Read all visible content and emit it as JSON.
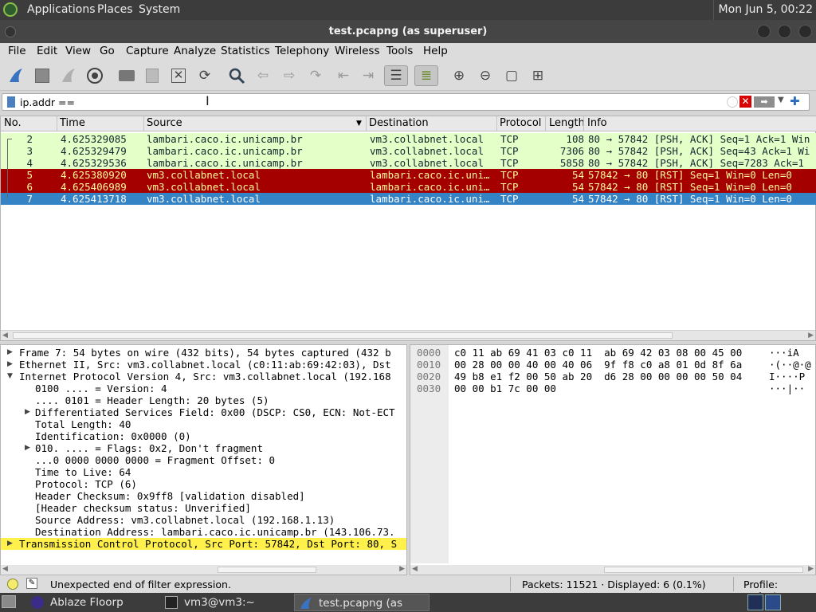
{
  "top_panel": {
    "applications": "Applications",
    "places": "Places",
    "system": "System",
    "clock": "Mon Jun  5, 00:22"
  },
  "window": {
    "title": "test.pcapng (as superuser)"
  },
  "menu": [
    "File",
    "Edit",
    "View",
    "Go",
    "Capture",
    "Analyze",
    "Statistics",
    "Telephony",
    "Wireless",
    "Tools",
    "Help"
  ],
  "filter": {
    "value": "ip.addr =="
  },
  "columns": {
    "no": "No.",
    "time": "Time",
    "source": "Source",
    "destination": "Destination",
    "protocol": "Protocol",
    "length": "Length",
    "info": "Info"
  },
  "packets": [
    {
      "no": "2",
      "time": "4.625329085",
      "src": "lambari.caco.ic.unicamp.br",
      "dst": "vm3.collabnet.local",
      "proto": "TCP",
      "len": "108",
      "info": "80 → 57842 [PSH, ACK] Seq=1 Ack=1 Win"
    },
    {
      "no": "3",
      "time": "4.625329479",
      "src": "lambari.caco.ic.unicamp.br",
      "dst": "vm3.collabnet.local",
      "proto": "TCP",
      "len": "7306",
      "info": "80 → 57842 [PSH, ACK] Seq=43 Ack=1 Wi"
    },
    {
      "no": "4",
      "time": "4.625329536",
      "src": "lambari.caco.ic.unicamp.br",
      "dst": "vm3.collabnet.local",
      "proto": "TCP",
      "len": "5858",
      "info": "80 → 57842 [PSH, ACK] Seq=7283 Ack=1"
    },
    {
      "no": "5",
      "time": "4.625380920",
      "src": "vm3.collabnet.local",
      "dst": "lambari.caco.ic.uni…",
      "proto": "TCP",
      "len": "54",
      "info": "57842 → 80 [RST] Seq=1 Win=0 Len=0"
    },
    {
      "no": "6",
      "time": "4.625406989",
      "src": "vm3.collabnet.local",
      "dst": "lambari.caco.ic.uni…",
      "proto": "TCP",
      "len": "54",
      "info": "57842 → 80 [RST] Seq=1 Win=0 Len=0"
    },
    {
      "no": "7",
      "time": "4.625413718",
      "src": "vm3.collabnet.local",
      "dst": "lambari.caco.ic.uni…",
      "proto": "TCP",
      "len": "54",
      "info": "57842 → 80 [RST] Seq=1 Win=0 Len=0"
    }
  ],
  "details": [
    "Frame 7: 54 bytes on wire (432 bits), 54 bytes captured (432 b",
    "Ethernet II, Src: vm3.collabnet.local (c0:11:ab:69:42:03), Dst",
    "Internet Protocol Version 4, Src: vm3.collabnet.local (192.168",
    "0100 .... = Version: 4",
    ".... 0101 = Header Length: 20 bytes (5)",
    "Differentiated Services Field: 0x00 (DSCP: CS0, ECN: Not-ECT",
    "Total Length: 40",
    "Identification: 0x0000 (0)",
    "010. .... = Flags: 0x2, Don't fragment",
    "...0 0000 0000 0000 = Fragment Offset: 0",
    "Time to Live: 64",
    "Protocol: TCP (6)",
    "Header Checksum: 0x9ff8 [validation disabled]",
    "[Header checksum status: Unverified]",
    "Source Address: vm3.collabnet.local (192.168.1.13)",
    "Destination Address: lambari.caco.ic.unicamp.br (143.106.73.",
    "Transmission Control Protocol, Src Port: 57842, Dst Port: 80, S"
  ],
  "bytes": [
    {
      "off": "0000",
      "hex": "c0 11 ab 69 41 03 c0 11  ab 69 42 03 08 00 45 00",
      "ascii": "···iA"
    },
    {
      "off": "0010",
      "hex": "00 28 00 00 40 00 40 06  9f f8 c0 a8 01 0d 8f 6a",
      "ascii": "·(··@·@"
    },
    {
      "off": "0020",
      "hex": "49 b8 e1 f2 00 50 ab 20  d6 28 00 00 00 00 50 04",
      "ascii": "I····P"
    },
    {
      "off": "0030",
      "hex": "00 00 b1 7c 00 00",
      "ascii": "···|··"
    }
  ],
  "status": {
    "message": "Unexpected end of filter expression.",
    "packets": "Packets: 11521 · Displayed: 6 (0.1%)",
    "profile": "Profile: Default"
  },
  "taskbar": [
    "Ablaze Floorp",
    "vm3@vm3:~",
    "test.pcapng (as supe…"
  ],
  "colors": {
    "green_row": "#e4ffc7",
    "red_row": "#a40000",
    "selected_row": "#3484c5",
    "highlight": "#fff04c"
  }
}
